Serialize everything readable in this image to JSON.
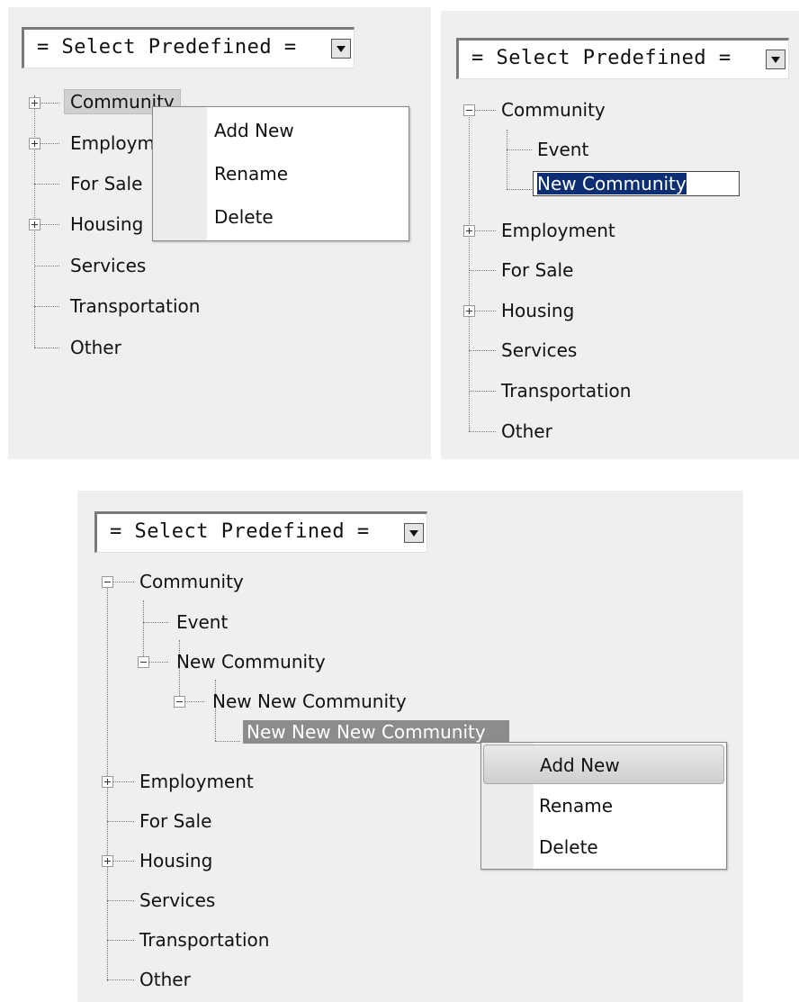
{
  "select": {
    "label": "= Select Predefined ="
  },
  "panel1": {
    "tree": [
      "Community",
      "Employment",
      "For Sale",
      "Housing",
      "Services",
      "Transportation",
      "Other"
    ],
    "menu": [
      "Add New",
      "Rename",
      "Delete"
    ]
  },
  "panel2": {
    "tree": [
      "Community",
      "Event",
      "New Community",
      "Employment",
      "For Sale",
      "Housing",
      "Services",
      "Transportation",
      "Other"
    ]
  },
  "panel3": {
    "tree": [
      "Community",
      "Event",
      "New Community",
      "New New Community",
      "New New New Community",
      "Employment",
      "For Sale",
      "Housing",
      "Services",
      "Transportation",
      "Other"
    ],
    "menu": [
      "Add New",
      "Rename",
      "Delete"
    ]
  }
}
